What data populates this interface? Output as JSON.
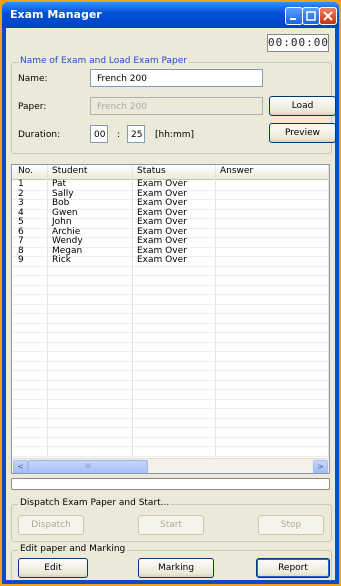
{
  "window": {
    "title": "Exam Manager",
    "timer": "00:00:00",
    "controls": {
      "minimize": "minimize-icon",
      "maximize": "maximize-icon",
      "close": "close-icon"
    }
  },
  "load_section": {
    "legend": "Name of Exam and Load Exam Paper",
    "name_label": "Name:",
    "name_value": "French 200",
    "paper_label": "Paper:",
    "paper_value": "French 200",
    "duration_label": "Duration:",
    "duration_hours": "00",
    "duration_sep": ":",
    "duration_minutes": "25",
    "duration_unit": "[hh:mm]",
    "load_button": "Load",
    "preview_button": "Preview"
  },
  "table": {
    "columns": [
      "No.",
      "Student",
      "Status",
      "Answer"
    ],
    "rows": [
      {
        "no": "1",
        "student": "Pat",
        "status": "Exam Over",
        "answer": ""
      },
      {
        "no": "2",
        "student": "Sally",
        "status": "Exam Over",
        "answer": ""
      },
      {
        "no": "3",
        "student": "Bob",
        "status": "Exam Over",
        "answer": ""
      },
      {
        "no": "4",
        "student": "Gwen",
        "status": "Exam Over",
        "answer": ""
      },
      {
        "no": "5",
        "student": "John",
        "status": "Exam Over",
        "answer": ""
      },
      {
        "no": "6",
        "student": "Archie",
        "status": "Exam Over",
        "answer": ""
      },
      {
        "no": "7",
        "student": "Wendy",
        "status": "Exam Over",
        "answer": ""
      },
      {
        "no": "8",
        "student": "Megan",
        "status": "Exam Over",
        "answer": ""
      },
      {
        "no": "9",
        "student": "Rick",
        "status": "Exam Over",
        "answer": ""
      }
    ],
    "scroll_left": "<",
    "scroll_right": ">",
    "scroll_thumb_grip": "III"
  },
  "progress": {
    "value": 0
  },
  "dispatch_section": {
    "legend": "Dispatch Exam Paper and Start...",
    "dispatch_button": "Dispatch",
    "start_button": "Start",
    "stop_button": "Stop"
  },
  "marking_section": {
    "legend": "Edit paper and Marking",
    "edit_button": "Edit",
    "marking_button": "Marking",
    "report_button": "Report"
  },
  "colors": {
    "titlebar": "#0050d8",
    "client": "#ece9d8",
    "background": "#f0a020",
    "legend_blue": "#2050c8"
  }
}
